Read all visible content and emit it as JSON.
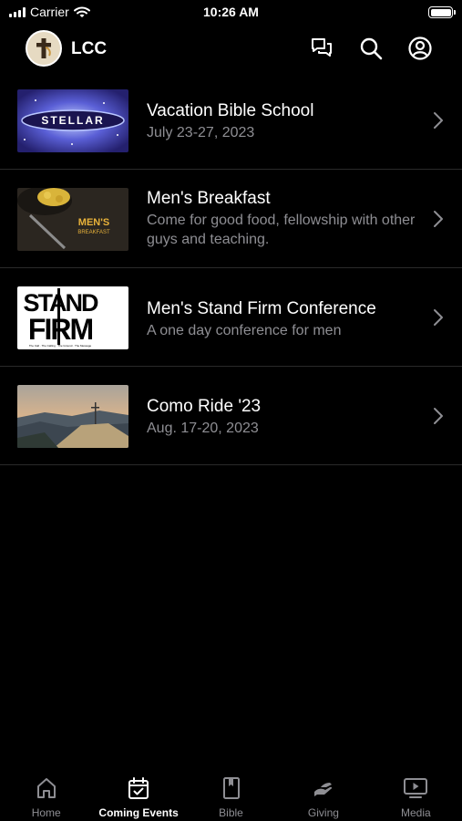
{
  "status_bar": {
    "carrier": "Carrier",
    "time": "10:26 AM"
  },
  "header": {
    "title": "LCC"
  },
  "events": [
    {
      "title": "Vacation Bible School",
      "subtitle": "July 23-27, 2023",
      "image_text": "STELLAR"
    },
    {
      "title": "Men's Breakfast",
      "subtitle": "Come for good food, fellowship with other guys and teaching.",
      "image_text": "MEN'S BREAKFAST"
    },
    {
      "title": "Men's Stand Firm Conference",
      "subtitle": "A one day conference for men",
      "image_text": "STAND FIRM"
    },
    {
      "title": "Como Ride '23",
      "subtitle": "Aug. 17-20, 2023",
      "image_text": ""
    }
  ],
  "tabs": [
    {
      "label": "Home",
      "icon": "home-icon",
      "active": false
    },
    {
      "label": "Coming Events",
      "icon": "calendar-icon",
      "active": true
    },
    {
      "label": "Bible",
      "icon": "book-icon",
      "active": false
    },
    {
      "label": "Giving",
      "icon": "giving-hand-icon",
      "active": false
    },
    {
      "label": "Media",
      "icon": "media-play-icon",
      "active": false
    }
  ],
  "colors": {
    "background": "#000000",
    "text": "#ffffff",
    "muted": "#8e8e93",
    "divider": "#2a2a2a"
  }
}
